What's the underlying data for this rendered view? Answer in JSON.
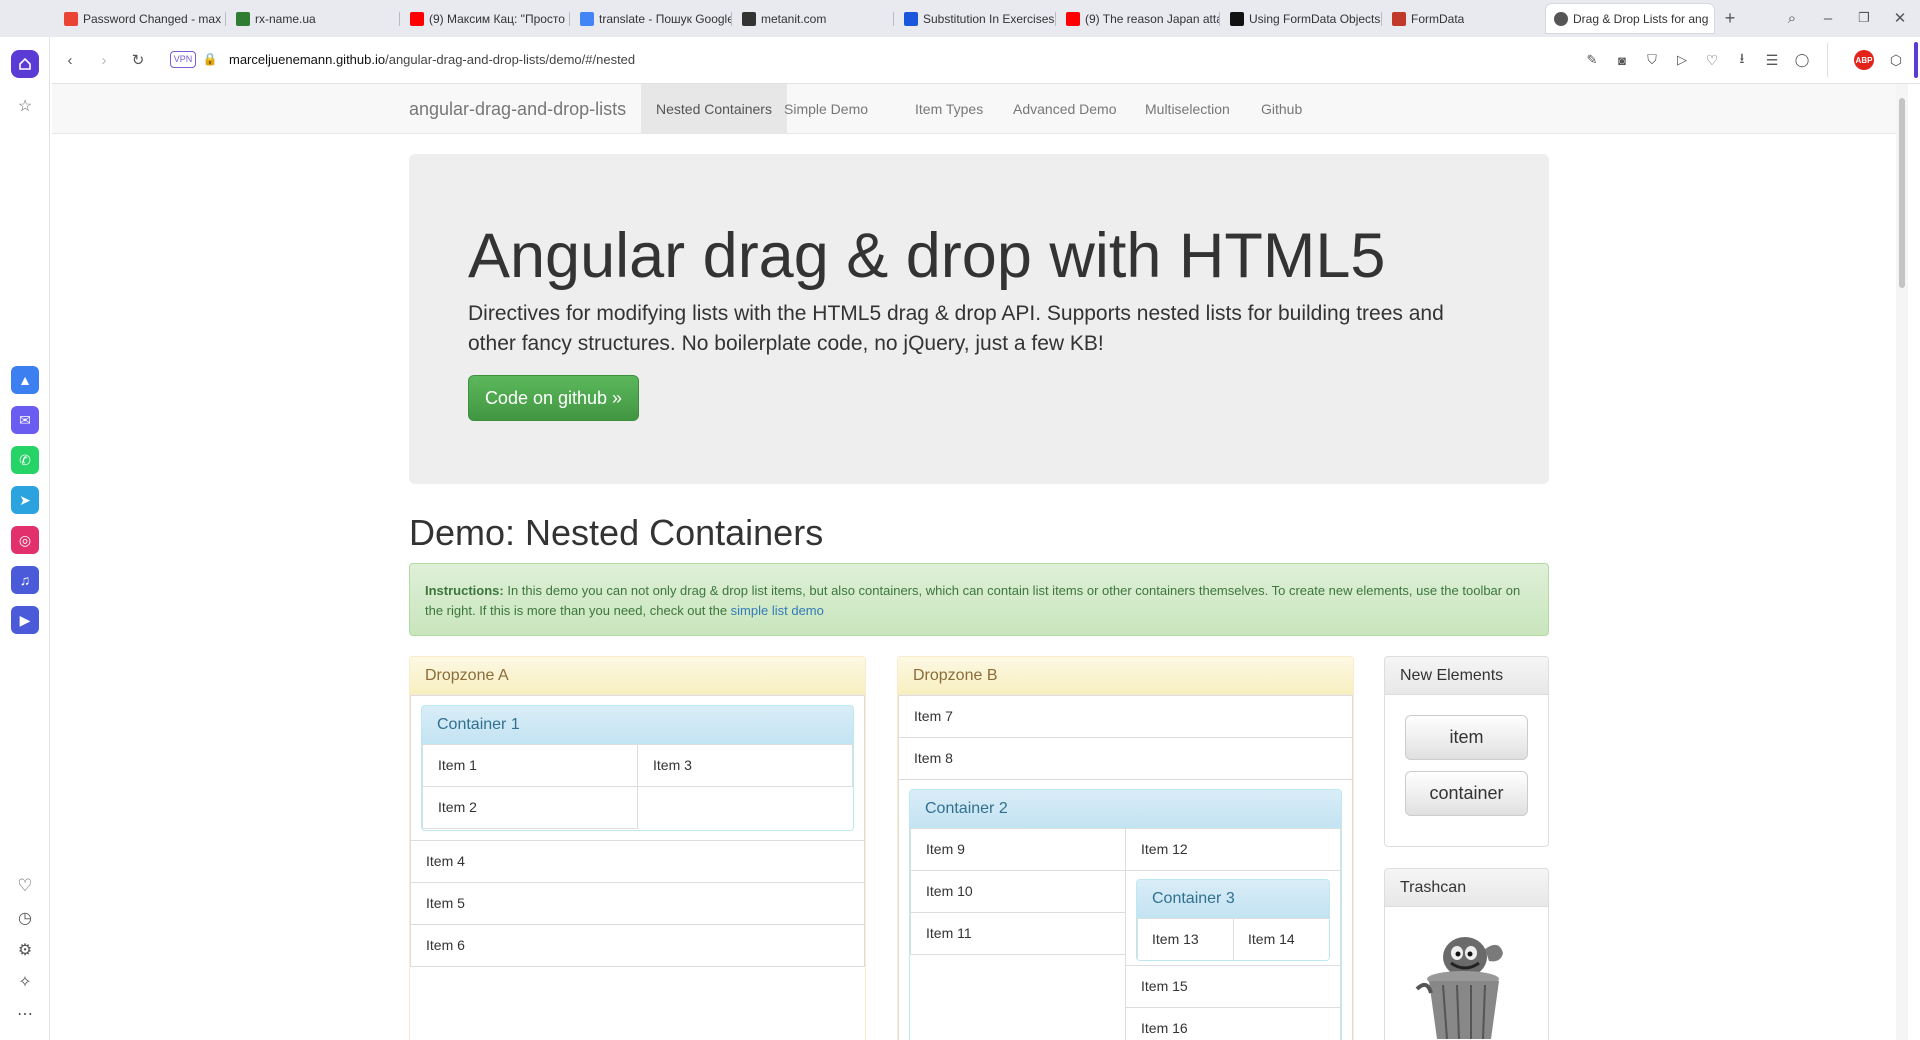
{
  "browser": {
    "tabs": [
      {
        "title": "Password Changed - max",
        "icon": "gmail-icon",
        "color": "#ea4335"
      },
      {
        "title": "rx-name.ua",
        "icon": "rx-icon",
        "color": "#2e7d32"
      },
      {
        "title": "(9) Максим Кац: \"Просто",
        "icon": "youtube-icon",
        "color": "#ff0000"
      },
      {
        "title": "translate - Пошук Google",
        "icon": "google-icon",
        "color": "#4285f4"
      },
      {
        "title": "metanit.com",
        "icon": "metanit-icon",
        "color": "#333333"
      },
      {
        "title": "Substitution In Exercises",
        "icon": "filo-icon",
        "color": "#1a56db"
      },
      {
        "title": "(9) The reason Japan atta",
        "icon": "youtube-icon",
        "color": "#ff0000"
      },
      {
        "title": "Using FormData Objects",
        "icon": "mdn-icon",
        "color": "#111111"
      },
      {
        "title": "FormData",
        "icon": "formdata-icon",
        "color": "#c0392b"
      },
      {
        "title": "Drag & Drop Lists for ang",
        "icon": "globe-icon",
        "color": "#555555"
      }
    ],
    "address": {
      "vpn_label": "VPN",
      "url_host": "marceljuenemann.github.io",
      "url_path": "/angular-drag-and-drop-lists/demo/#/nested"
    }
  },
  "site": {
    "brand": "angular-drag-and-drop-lists",
    "nav": [
      "Nested Containers",
      "Simple Demo",
      "Item Types",
      "Advanced Demo",
      "Multiselection",
      "Github"
    ],
    "active_nav": "Nested Containers"
  },
  "jumbotron": {
    "title": "Angular drag & drop with HTML5",
    "lead": "Directives for modifying lists with the HTML5 drag & drop API. Supports nested lists for building trees and other fancy structures. No boilerplate code, no jQuery, just a few KB!",
    "button": "Code on github »"
  },
  "demo": {
    "title": "Demo: Nested Containers",
    "instructions_label": "Instructions:",
    "instructions_text": " In this demo you can not only drag & drop list items, but also containers, which can contain list items or other containers themselves. To create new elements, use the toolbar on the right. If this is more than you need, check out the ",
    "instructions_link": "simple list demo"
  },
  "dropzone_a": {
    "title": "Dropzone A",
    "container1": {
      "title": "Container 1",
      "col1": [
        "Item 1",
        "Item 2"
      ],
      "col2": [
        "Item 3"
      ]
    },
    "items": [
      "Item 4",
      "Item 5",
      "Item 6"
    ]
  },
  "dropzone_b": {
    "title": "Dropzone B",
    "items": [
      "Item 7",
      "Item 8"
    ],
    "container2": {
      "title": "Container 2",
      "col1": [
        "Item 9",
        "Item 10",
        "Item 11"
      ],
      "col2_top": [
        "Item 12"
      ],
      "container3": {
        "title": "Container 3",
        "col1": [
          "Item 13"
        ],
        "col2": [
          "Item 14"
        ]
      },
      "col2_bottom": [
        "Item 15",
        "Item 16"
      ]
    }
  },
  "new_elements": {
    "title": "New Elements",
    "buttons": [
      "item",
      "container"
    ]
  },
  "trashcan": {
    "title": "Trashcan"
  }
}
